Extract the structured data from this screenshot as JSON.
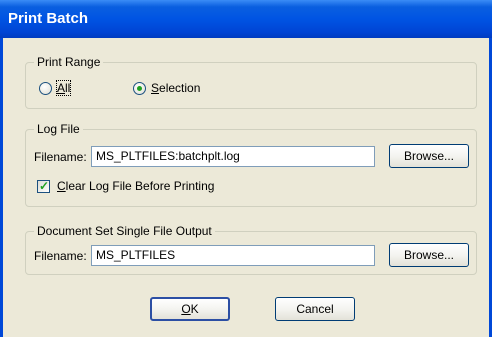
{
  "window": {
    "title": "Print Batch"
  },
  "print_range": {
    "legend": "Print Range",
    "option_all": {
      "prefix": "",
      "mnemonic": "A",
      "rest": "ll",
      "selected": false
    },
    "option_selection": {
      "prefix": "",
      "mnemonic": "S",
      "rest": "election",
      "selected": true
    }
  },
  "log_file": {
    "legend": "Log File",
    "filename_label": "Filename:",
    "filename_value": "MS_PLTFILES:batchplt.log",
    "browse_label": "Browse...",
    "clear_checkbox": {
      "mnemonic": "C",
      "rest": "lear Log File Before Printing",
      "checked": true
    }
  },
  "doc_set": {
    "legend": "Document Set Single File Output",
    "filename_label": "Filename:",
    "filename_value": "MS_PLTFILES",
    "browse_label": "Browse..."
  },
  "buttons": {
    "ok": {
      "mnemonic": "O",
      "rest": "K"
    },
    "cancel": "Cancel"
  }
}
